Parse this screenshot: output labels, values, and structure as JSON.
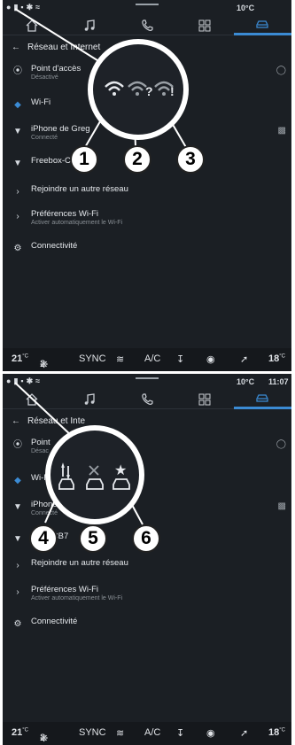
{
  "screens": [
    {
      "status": {
        "temp": "10°C",
        "time": ""
      },
      "header_title": "Réseau et Internet",
      "items": [
        {
          "label": "Point d'accès",
          "sub": "Désactivé"
        },
        {
          "label": "Wi-Fi",
          "sub": ""
        },
        {
          "label": "iPhone de Greg",
          "sub": "Connecté"
        },
        {
          "label": "Freebox-C",
          "sub": ""
        },
        {
          "label": "Rejoindre un autre réseau",
          "sub": ""
        },
        {
          "label": "Préférences Wi-Fi",
          "sub": "Activer automatiquement le Wi-Fi"
        },
        {
          "label": "Connectivité",
          "sub": ""
        }
      ],
      "callouts": [
        "1",
        "2",
        "3"
      ],
      "bottom": {
        "temp_left": "21",
        "unit_left": "°C",
        "fan": "2",
        "sync": "SYNC",
        "ac": "A/C",
        "temp_right": "18",
        "unit_right": "°C"
      }
    },
    {
      "status": {
        "temp": "10°C",
        "time": "11:07"
      },
      "header_title": "Réseau et Inte",
      "items": [
        {
          "label": "Point",
          "sub": "Désac"
        },
        {
          "label": "Wi-F",
          "sub": ""
        },
        {
          "label": "iPhone de",
          "sub": "Connecté"
        },
        {
          "label": "ebox-CB7",
          "sub": ""
        },
        {
          "label": "Rejoindre un autre réseau",
          "sub": ""
        },
        {
          "label": "Préférences Wi-Fi",
          "sub": "Activer automatiquement le Wi-Fi"
        },
        {
          "label": "Connectivité",
          "sub": ""
        }
      ],
      "callouts": [
        "4",
        "5",
        "6"
      ],
      "bottom": {
        "temp_left": "21",
        "unit_left": "°C",
        "fan": "2",
        "sync": "SYNC",
        "ac": "A/C",
        "temp_right": "18",
        "unit_right": "°C"
      }
    }
  ],
  "colors": {
    "bg": "#1b1f24",
    "accent": "#3b8bd4",
    "text": "#e6e9ed",
    "sub": "#8a9096"
  },
  "icons": {
    "tabs": [
      "home-icon",
      "music-icon",
      "phone-icon",
      "apps-icon",
      "car-icon"
    ],
    "zoom1": [
      "wifi-signal-icon",
      "wifi-unknown-icon",
      "wifi-warning-icon"
    ],
    "zoom2": [
      "car-data-transfer-icon",
      "car-not-connected-icon",
      "car-favorite-icon"
    ]
  }
}
